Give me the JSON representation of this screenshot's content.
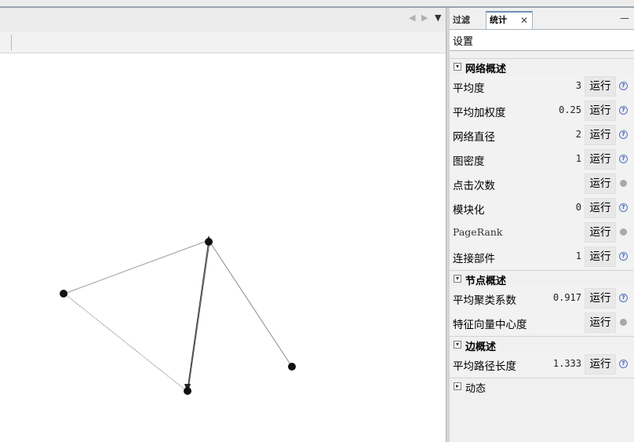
{
  "graph_view": {
    "nav_prev": "◀",
    "nav_next": "▶",
    "nav_menu": "▼",
    "nodes": [
      {
        "id": "n1"
      },
      {
        "id": "n2"
      },
      {
        "id": "n3"
      },
      {
        "id": "n4"
      }
    ],
    "edges": [
      {
        "from": "n2",
        "to": "n1"
      },
      {
        "from": "n2",
        "to": "n3"
      },
      {
        "from": "n1",
        "to": "n3"
      },
      {
        "from": "n3",
        "to": "n1"
      },
      {
        "from": "n1",
        "to": "n4"
      }
    ]
  },
  "panel": {
    "tab_filter": "过滤",
    "tab_statistics": "统计",
    "tab_close": "✕",
    "minimize": "—",
    "settings_label": "设置",
    "sections": [
      {
        "title": "网络概述",
        "toggle": "▾",
        "rows": [
          {
            "label": "平均度",
            "value": "3",
            "run": "运行",
            "info": "help"
          },
          {
            "label": "平均加权度",
            "value": "0.25",
            "run": "运行",
            "info": "help"
          },
          {
            "label": "网络直径",
            "value": "2",
            "run": "运行",
            "info": "help"
          },
          {
            "label": "图密度",
            "value": "1",
            "run": "运行",
            "info": "help"
          },
          {
            "label": "点击次数",
            "value": "",
            "run": "运行",
            "info": "dot"
          },
          {
            "label": "模块化",
            "value": "0",
            "run": "运行",
            "info": "help"
          },
          {
            "label": "PageRank",
            "value": "",
            "run": "运行",
            "info": "dot"
          },
          {
            "label": "连接部件",
            "value": "1",
            "run": "运行",
            "info": "help"
          }
        ]
      },
      {
        "title": "节点概述",
        "toggle": "▾",
        "rows": [
          {
            "label": "平均聚类系数",
            "value": "0.917",
            "run": "运行",
            "info": "help"
          },
          {
            "label": "特征向量中心度",
            "value": "",
            "run": "运行",
            "info": "dot"
          }
        ]
      },
      {
        "title": "边概述",
        "toggle": "▾",
        "rows": [
          {
            "label": "平均路径长度",
            "value": "1.333",
            "run": "运行",
            "info": "help"
          }
        ]
      },
      {
        "title": "动态",
        "toggle": "▸",
        "rows": []
      }
    ],
    "help_glyph": "?"
  }
}
